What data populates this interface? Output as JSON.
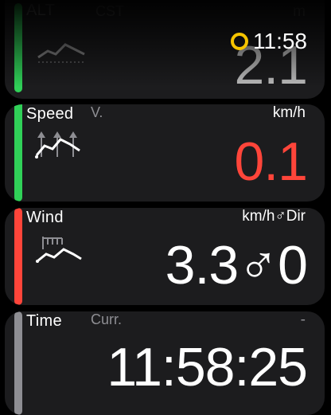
{
  "status": {
    "time": "11:58",
    "ring_color": "#f5c400"
  },
  "cards": {
    "alt": {
      "title": "ALT",
      "sub": "CST",
      "unit": "m",
      "value": "2.1",
      "bar_color": "#30d158"
    },
    "speed": {
      "title": "Speed",
      "sub": "V.",
      "unit": "km/h",
      "value": "0.1",
      "bar_color": "#30d158",
      "value_color": "#ff453a",
      "icon": "speed-chart-icon"
    },
    "wind": {
      "title": "Wind",
      "unit": "km/h♂Dir",
      "value": "3.3♂0",
      "bar_color": "#ff453a",
      "icon": "wind-chart-icon"
    },
    "time": {
      "title": "Time",
      "sub": "Curr.",
      "unit": "-",
      "value": "11:58:25",
      "bar_color": "#8e8e93"
    }
  }
}
